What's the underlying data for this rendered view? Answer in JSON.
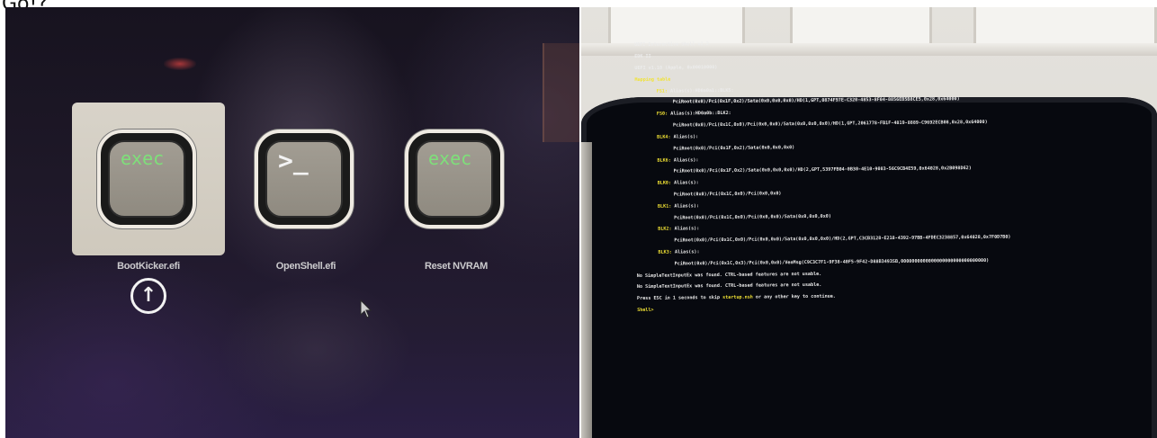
{
  "caption": "Go!?",
  "boot_picker": {
    "entries": [
      {
        "label": "BootKicker.efi",
        "icon_text": "exec",
        "selected": true
      },
      {
        "label": "OpenShell.efi",
        "icon_text": ">_",
        "selected": false
      },
      {
        "label": "Reset NVRAM",
        "icon_text": "exec",
        "selected": false
      }
    ],
    "arrow_icon": "↑",
    "accent_green": "#7ee07a"
  },
  "uefi_shell": {
    "header": [
      "UEFI Interactive Shell v2.2",
      "EDK II",
      "UEFI v1.10 (Apple, 0x00010000)"
    ],
    "mapping_title": "Mapping table",
    "mappings": [
      {
        "name": "FS1:",
        "alias": "Alias(s):HD0a0a1::BLK5:",
        "path": "PciRoot(0x0)/Pci(0x1F,0x2)/Sata(0x0,0x0,0x0)/HD(1,GPT,0874F97E-C320-4853-8F04-8856EB5B8CE5,0x28,0x64000)"
      },
      {
        "name": "FS0:",
        "alias": "Alias(s):HD0a0b::BLK2:",
        "path": "PciRoot(0x0)/Pci(0x1C,0x0)/Pci(0x0,0x0)/Sata(0x0,0x0,0x0)/HD(1,GPT,2061778-FB1F-4819-8889-C9692ECB08,0x28,0x64000)"
      },
      {
        "name": "BLK4:",
        "alias": "Alias(s):",
        "path": "PciRoot(0x0)/Pci(0x1F,0x2)/Sata(0x0,0x0,0x0)"
      },
      {
        "name": "BLK6:",
        "alias": "Alias(s):",
        "path": "PciRoot(0x0)/Pci(0x1F,0x2)/Sata(0x0,0x0,0x0)/HD(2,GPT,5397FB04-0B30-4E10-9083-56C9CB4E59,0x64028,0x2B098D62)"
      },
      {
        "name": "BLK0:",
        "alias": "Alias(s):",
        "path": "PciRoot(0x0)/Pci(0x1C,0x0)/Pci(0x0,0x0)"
      },
      {
        "name": "BLK1:",
        "alias": "Alias(s):",
        "path": "PciRoot(0x0)/Pci(0x1C,0x0)/Pci(0x0,0x0)/Sata(0x0,0x0,0x0)"
      },
      {
        "name": "BLK2:",
        "alias": "Alias(s):",
        "path": "PciRoot(0x0)/Pci(0x1C,0x0)/Pci(0x0,0x0)/Sata(0x0,0x0,0x0)/HD(2,GPT,C3CB3128-E218-4392-97BB-4FDEC3238857,0x64028,0x7F0D7B0)"
      },
      {
        "name": "BLK3:",
        "alias": "Alias(s):",
        "path": "PciRoot(0x0)/Pci(0x1C,0x3)/Pci(0x0,0x0)/VenMsg(C9C3C7F1-9F38-40F5-9F42-D88B3493SB,0000000000000000000000000000000)"
      }
    ],
    "messages": [
      "No SimpleTextInputEx was found. CTRL-based features are not usable.",
      "No SimpleTextInputEx was found. CTRL-based features are not usable."
    ],
    "esc_prefix": "Press ESC in 1 seconds to skip ",
    "esc_script": "startup.nsh",
    "esc_suffix": " or any other key to continue.",
    "prompt": "Shell> ",
    "text_yellow": "#f1e234"
  }
}
